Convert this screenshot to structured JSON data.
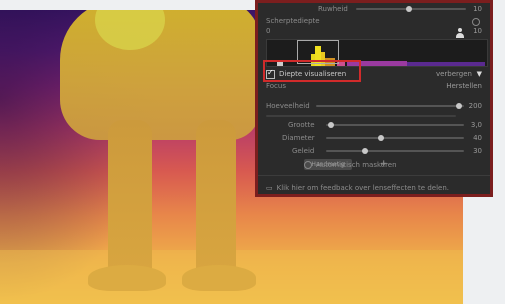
{
  "panel": {
    "top_partial_label": "Ruwheid",
    "top_partial_value": "10",
    "sharpness_label": "Scherptediepte",
    "sharpness_min": "0",
    "sharpness_max": "10",
    "visualize_label": "Diepte visualiseren",
    "hide_label": "verbergen",
    "focus_label": "Focus",
    "focus_button": "Handmatig",
    "reset_label": "Herstellen",
    "intensity_label": "Hoeveelheid",
    "intensity_value": "200",
    "size_label": "Grootte",
    "size_value": "3,0",
    "diameter_label": "Diameter",
    "diameter_value": "40",
    "gradient_label": "Geleid",
    "gradient_value": "30",
    "auto_mask_label": "Automatisch maskeren",
    "feedback_label": "Klik hier om feedback over lenseffecten te delen."
  },
  "colors": {
    "panel_bg": "#2b2b2b",
    "highlight": "#d12b2b",
    "overlay_top": "#3a1566",
    "overlay_bottom": "#f2c24c"
  }
}
